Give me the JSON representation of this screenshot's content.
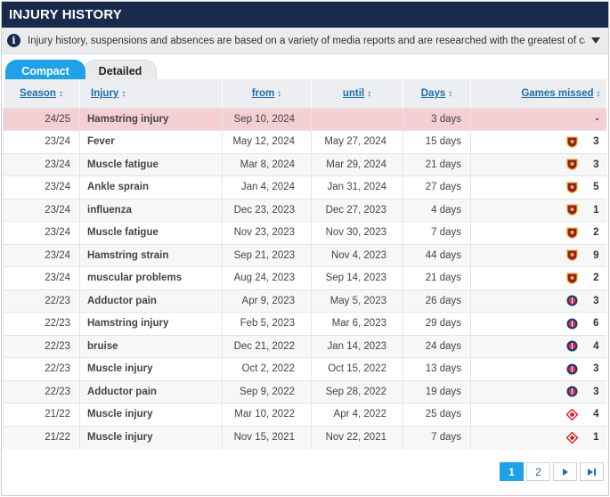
{
  "header": {
    "title": "INJURY HISTORY"
  },
  "notice": {
    "text": "Injury history, suspensions and absences are based on a variety of media reports and are researched with the greatest of care. If you should n..."
  },
  "tabs": [
    {
      "label": "Compact",
      "active": true
    },
    {
      "label": "Detailed",
      "active": false
    }
  ],
  "table": {
    "columns": [
      "Season",
      "Injury",
      "from",
      "until",
      "Days",
      "Games missed"
    ],
    "rows": [
      {
        "season": "24/25",
        "injury": "Hamstring injury",
        "from": "Sep 10, 2024",
        "until": "",
        "days": "3 days",
        "club": "",
        "games": "-",
        "current": true
      },
      {
        "season": "23/24",
        "injury": "Fever",
        "from": "May 12, 2024",
        "until": "May 27, 2024",
        "days": "15 days",
        "club": "roma",
        "games": "3"
      },
      {
        "season": "23/24",
        "injury": "Muscle fatigue",
        "from": "Mar 8, 2024",
        "until": "Mar 29, 2024",
        "days": "21 days",
        "club": "roma",
        "games": "3"
      },
      {
        "season": "23/24",
        "injury": "Ankle sprain",
        "from": "Jan 4, 2024",
        "until": "Jan 31, 2024",
        "days": "27 days",
        "club": "roma",
        "games": "5"
      },
      {
        "season": "23/24",
        "injury": "influenza",
        "from": "Dec 23, 2023",
        "until": "Dec 27, 2023",
        "days": "4 days",
        "club": "roma",
        "games": "1"
      },
      {
        "season": "23/24",
        "injury": "Muscle fatigue",
        "from": "Nov 23, 2023",
        "until": "Nov 30, 2023",
        "days": "7 days",
        "club": "roma",
        "games": "2"
      },
      {
        "season": "23/24",
        "injury": "Hamstring strain",
        "from": "Sep 21, 2023",
        "until": "Nov 4, 2023",
        "days": "44 days",
        "club": "roma",
        "games": "9"
      },
      {
        "season": "23/24",
        "injury": "muscular problems",
        "from": "Aug 24, 2023",
        "until": "Sep 14, 2023",
        "days": "21 days",
        "club": "roma",
        "games": "2"
      },
      {
        "season": "22/23",
        "injury": "Adductor pain",
        "from": "Apr 9, 2023",
        "until": "May 5, 2023",
        "days": "26 days",
        "club": "psg",
        "games": "3"
      },
      {
        "season": "22/23",
        "injury": "Hamstring injury",
        "from": "Feb 5, 2023",
        "until": "Mar 6, 2023",
        "days": "29 days",
        "club": "psg",
        "games": "6"
      },
      {
        "season": "22/23",
        "injury": "bruise",
        "from": "Dec 21, 2022",
        "until": "Jan 14, 2023",
        "days": "24 days",
        "club": "psg",
        "games": "4"
      },
      {
        "season": "22/23",
        "injury": "Muscle injury",
        "from": "Oct 2, 2022",
        "until": "Oct 15, 2022",
        "days": "13 days",
        "club": "psg",
        "games": "3"
      },
      {
        "season": "22/23",
        "injury": "Adductor pain",
        "from": "Sep 9, 2022",
        "until": "Sep 28, 2022",
        "days": "19 days",
        "club": "psg",
        "games": "3"
      },
      {
        "season": "21/22",
        "injury": "Muscle injury",
        "from": "Mar 10, 2022",
        "until": "Apr 4, 2022",
        "days": "25 days",
        "club": "lille",
        "games": "4"
      },
      {
        "season": "21/22",
        "injury": "Muscle injury",
        "from": "Nov 15, 2021",
        "until": "Nov 22, 2021",
        "days": "7 days",
        "club": "lille",
        "games": "1"
      }
    ]
  },
  "pagination": {
    "pages": [
      "1",
      "2"
    ],
    "current": "1",
    "next_label": "▸",
    "last_label": "▸|"
  },
  "colors": {
    "header_bg": "#1a2a4d",
    "accent": "#1ea1e6",
    "link": "#1d6fa8",
    "current_row": "#f4cfd4"
  }
}
